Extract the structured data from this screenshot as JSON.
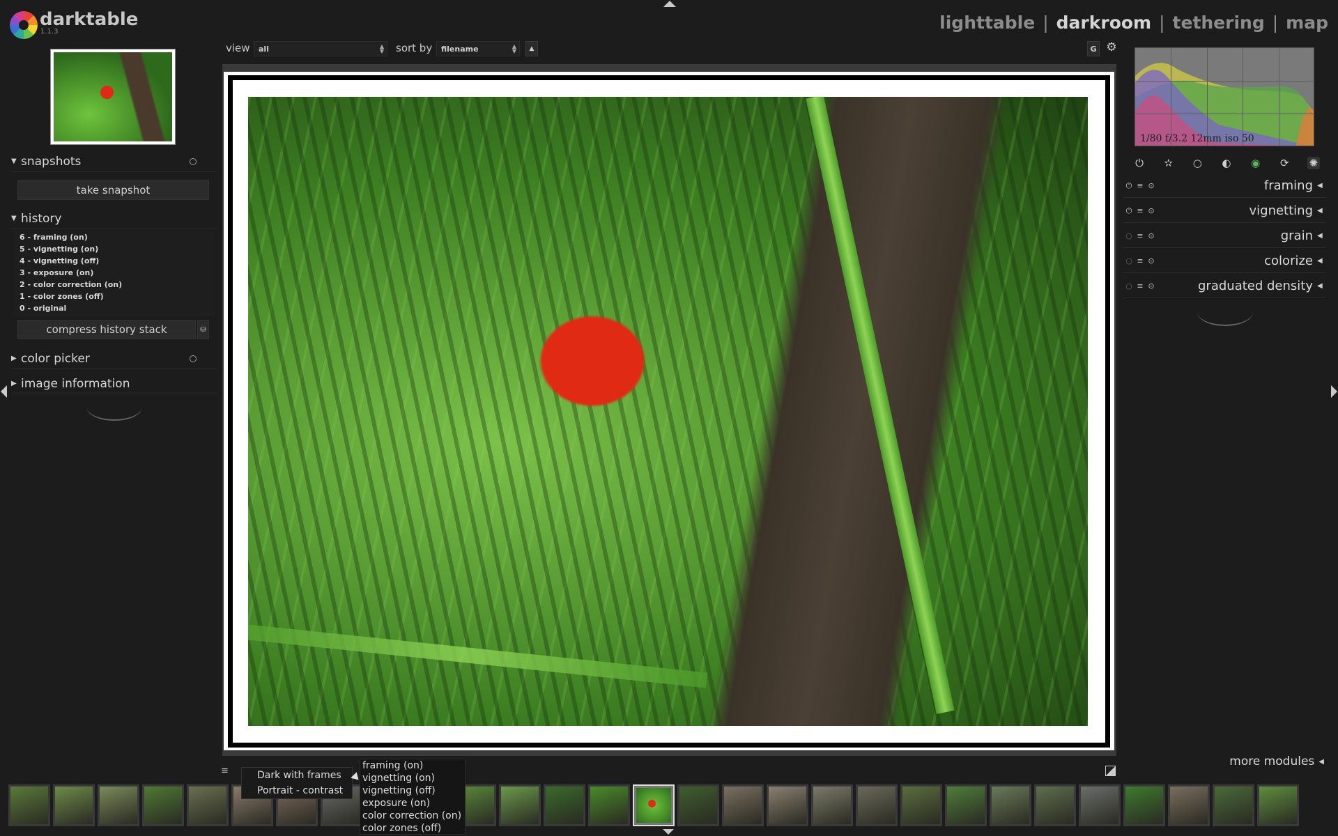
{
  "header": {
    "app_name": "darktable",
    "version": "1.1.3",
    "views": [
      "lighttable",
      "darkroom",
      "tethering",
      "map"
    ],
    "active_view": "darkroom"
  },
  "left_panel": {
    "snapshots": {
      "title": "snapshots",
      "take_button": "take snapshot"
    },
    "history": {
      "title": "history",
      "items": [
        "6 - framing (on)",
        "5 - vignetting (on)",
        "4 - vignetting (off)",
        "3 - exposure (on)",
        "2 - color correction (on)",
        "1 - color zones (off)",
        "0 - original"
      ],
      "compress_button": "compress history stack"
    },
    "color_picker": {
      "title": "color picker"
    },
    "image_information": {
      "title": "image information"
    }
  },
  "toolbar": {
    "view_label": "view",
    "view_value": "all",
    "sort_label": "sort by",
    "sort_value": "filename",
    "grouping_button": "G"
  },
  "right_panel": {
    "exif": "1/80 f/3.2 12mm iso 50",
    "group_icons": [
      "power-icon",
      "star-icon",
      "circle-icon",
      "tone-icon",
      "color-icon",
      "correct-icon",
      "effect-icon"
    ],
    "modules": [
      "framing",
      "vignetting",
      "grain",
      "colorize",
      "graduated density"
    ],
    "more_modules": "more modules"
  },
  "styles_menu": {
    "items": [
      "Dark with frames",
      "Portrait - contrast"
    ]
  },
  "style_preview": {
    "items": [
      "framing (on)",
      "vignetting (on)",
      "vignetting (off)",
      "exposure (on)",
      "color correction (on)",
      "color zones (off)"
    ]
  },
  "colors": {
    "background": "#1c1c1c",
    "accent_text": "#d4d4d4"
  }
}
